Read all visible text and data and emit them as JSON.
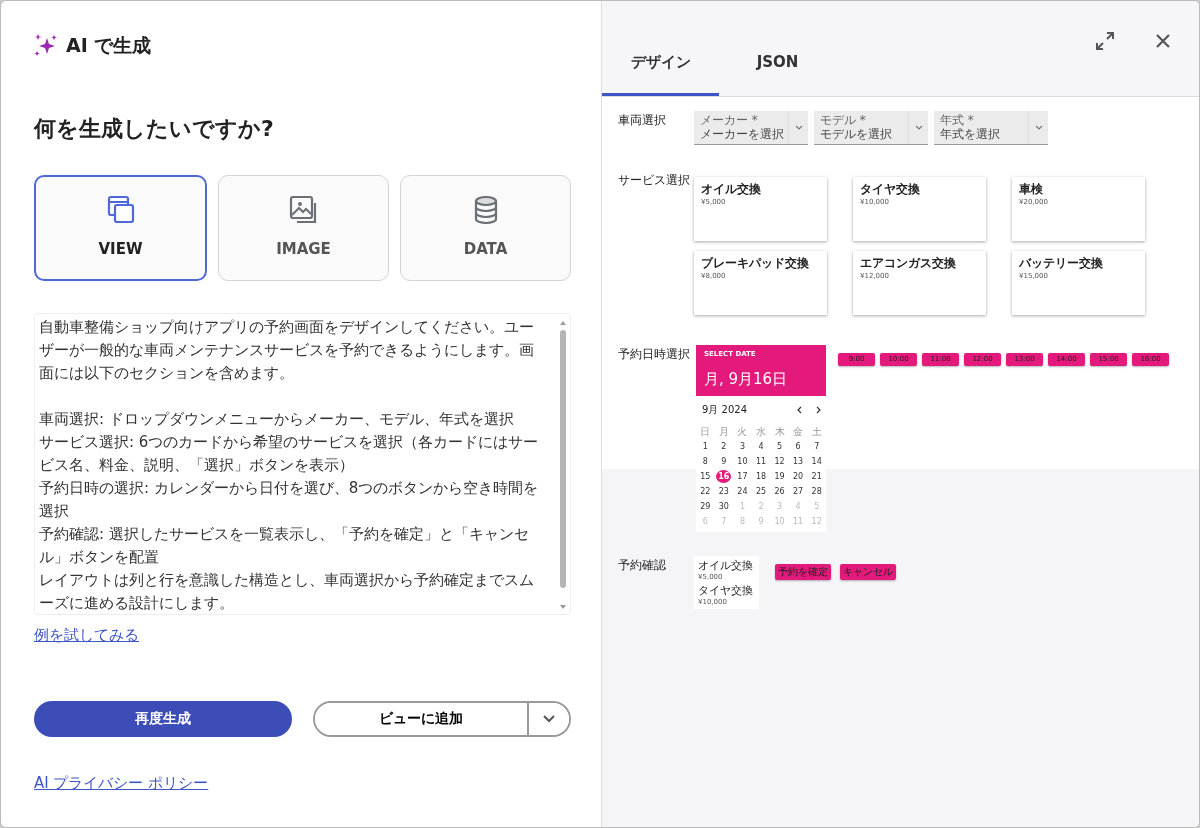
{
  "header": {
    "title": "AI で生成"
  },
  "question": "何を生成したいですか?",
  "types": [
    {
      "label": "VIEW",
      "kind": "view",
      "selected": true
    },
    {
      "label": "IMAGE",
      "kind": "image",
      "selected": false
    },
    {
      "label": "DATA",
      "kind": "data",
      "selected": false
    }
  ],
  "prompt": {
    "paragraphs": [
      [
        "自動車整備ショップ向けアプリの予約画面をデザインしてください。ユーザーが一般的な車両メンテナンスサービスを予約できるようにします。画面には以下のセクションを含めます。"
      ],
      [
        "車両選択: ドロップダウンメニューからメーカー、モデル、年式を選択",
        "サービス選択: 6つのカードから希望のサービスを選択（各カードにはサービス名、料金、説明、「選択」ボタンを表示）",
        "予約日時の選択: カレンダーから日付を選び、8つのボタンから空き時間を選択",
        "予約確認: 選択したサービスを一覧表示し、「予約を確定」と「キャンセル」ボタンを配置",
        "レイアウトは列と行を意識した構造とし、車両選択から予約確定までスムーズに進める設計にします。"
      ]
    ]
  },
  "example_link": "例を試してみる",
  "actions": {
    "regenerate": "再度生成",
    "add": "ビューに追加"
  },
  "privacy_link": "AI プライバシー ポリシー",
  "tabs": [
    {
      "label": "デザイン",
      "selected": true
    },
    {
      "label": "JSON",
      "selected": false
    }
  ],
  "preview": {
    "vehicle": {
      "label": "車両選択",
      "dropdowns": [
        {
          "label": "メーカー *",
          "placeholder": "メーカーを選択"
        },
        {
          "label": "モデル *",
          "placeholder": "モデルを選択"
        },
        {
          "label": "年式 *",
          "placeholder": "年式を選択"
        }
      ]
    },
    "services": {
      "label": "サービス選択",
      "cards": [
        {
          "name": "オイル交換",
          "price": "¥5,000"
        },
        {
          "name": "タイヤ交換",
          "price": "¥10,000"
        },
        {
          "name": "車検",
          "price": "¥20,000"
        },
        {
          "name": "ブレーキパッド交換",
          "price": "¥8,000"
        },
        {
          "name": "エアコンガス交換",
          "price": "¥12,000"
        },
        {
          "name": "バッテリー交換",
          "price": "¥15,000"
        }
      ]
    },
    "datetime": {
      "label": "予約日時選択",
      "calendar": {
        "caption": "SELECT DATE",
        "date": "月, 9月16日",
        "month": "9月 2024",
        "weekdays": [
          "日",
          "月",
          "火",
          "水",
          "木",
          "金",
          "土"
        ],
        "days": [
          {
            "text": "1",
            "muted": false,
            "selected": false
          },
          {
            "text": "2",
            "muted": false,
            "selected": false
          },
          {
            "text": "3",
            "muted": false,
            "selected": false
          },
          {
            "text": "4",
            "muted": false,
            "selected": false
          },
          {
            "text": "5",
            "muted": false,
            "selected": false
          },
          {
            "text": "6",
            "muted": false,
            "selected": false
          },
          {
            "text": "7",
            "muted": false,
            "selected": false
          },
          {
            "text": "8",
            "muted": false,
            "selected": false
          },
          {
            "text": "9",
            "muted": false,
            "selected": false
          },
          {
            "text": "10",
            "muted": false,
            "selected": false
          },
          {
            "text": "11",
            "muted": false,
            "selected": false
          },
          {
            "text": "12",
            "muted": false,
            "selected": false
          },
          {
            "text": "13",
            "muted": false,
            "selected": false
          },
          {
            "text": "14",
            "muted": false,
            "selected": false
          },
          {
            "text": "15",
            "muted": false,
            "selected": false
          },
          {
            "text": "16",
            "muted": false,
            "selected": true
          },
          {
            "text": "17",
            "muted": false,
            "selected": false
          },
          {
            "text": "18",
            "muted": false,
            "selected": false
          },
          {
            "text": "19",
            "muted": false,
            "selected": false
          },
          {
            "text": "20",
            "muted": false,
            "selected": false
          },
          {
            "text": "21",
            "muted": false,
            "selected": false
          },
          {
            "text": "22",
            "muted": false,
            "selected": false
          },
          {
            "text": "23",
            "muted": false,
            "selected": false
          },
          {
            "text": "24",
            "muted": false,
            "selected": false
          },
          {
            "text": "25",
            "muted": false,
            "selected": false
          },
          {
            "text": "26",
            "muted": false,
            "selected": false
          },
          {
            "text": "27",
            "muted": false,
            "selected": false
          },
          {
            "text": "28",
            "muted": false,
            "selected": false
          },
          {
            "text": "29",
            "muted": false,
            "selected": false
          },
          {
            "text": "30",
            "muted": false,
            "selected": false
          },
          {
            "text": "1",
            "muted": true,
            "selected": false
          },
          {
            "text": "2",
            "muted": true,
            "selected": false
          },
          {
            "text": "3",
            "muted": true,
            "selected": false
          },
          {
            "text": "4",
            "muted": true,
            "selected": false
          },
          {
            "text": "5",
            "muted": true,
            "selected": false
          },
          {
            "text": "6",
            "muted": true,
            "selected": false
          },
          {
            "text": "7",
            "muted": true,
            "selected": false
          },
          {
            "text": "8",
            "muted": true,
            "selected": false
          },
          {
            "text": "9",
            "muted": true,
            "selected": false
          },
          {
            "text": "10",
            "muted": true,
            "selected": false
          },
          {
            "text": "11",
            "muted": true,
            "selected": false
          },
          {
            "text": "12",
            "muted": true,
            "selected": false
          }
        ]
      },
      "times": [
        "9:00",
        "10:00",
        "11:00",
        "12:00",
        "13:00",
        "14:00",
        "15:00",
        "16:00"
      ]
    },
    "confirm": {
      "label": "予約確認",
      "items": [
        {
          "name": "オイル交換",
          "price": "¥5,000"
        },
        {
          "name": "タイヤ交換",
          "price": "¥10,000"
        }
      ],
      "buttons": [
        "予約を確定",
        "キャンセル"
      ]
    }
  }
}
